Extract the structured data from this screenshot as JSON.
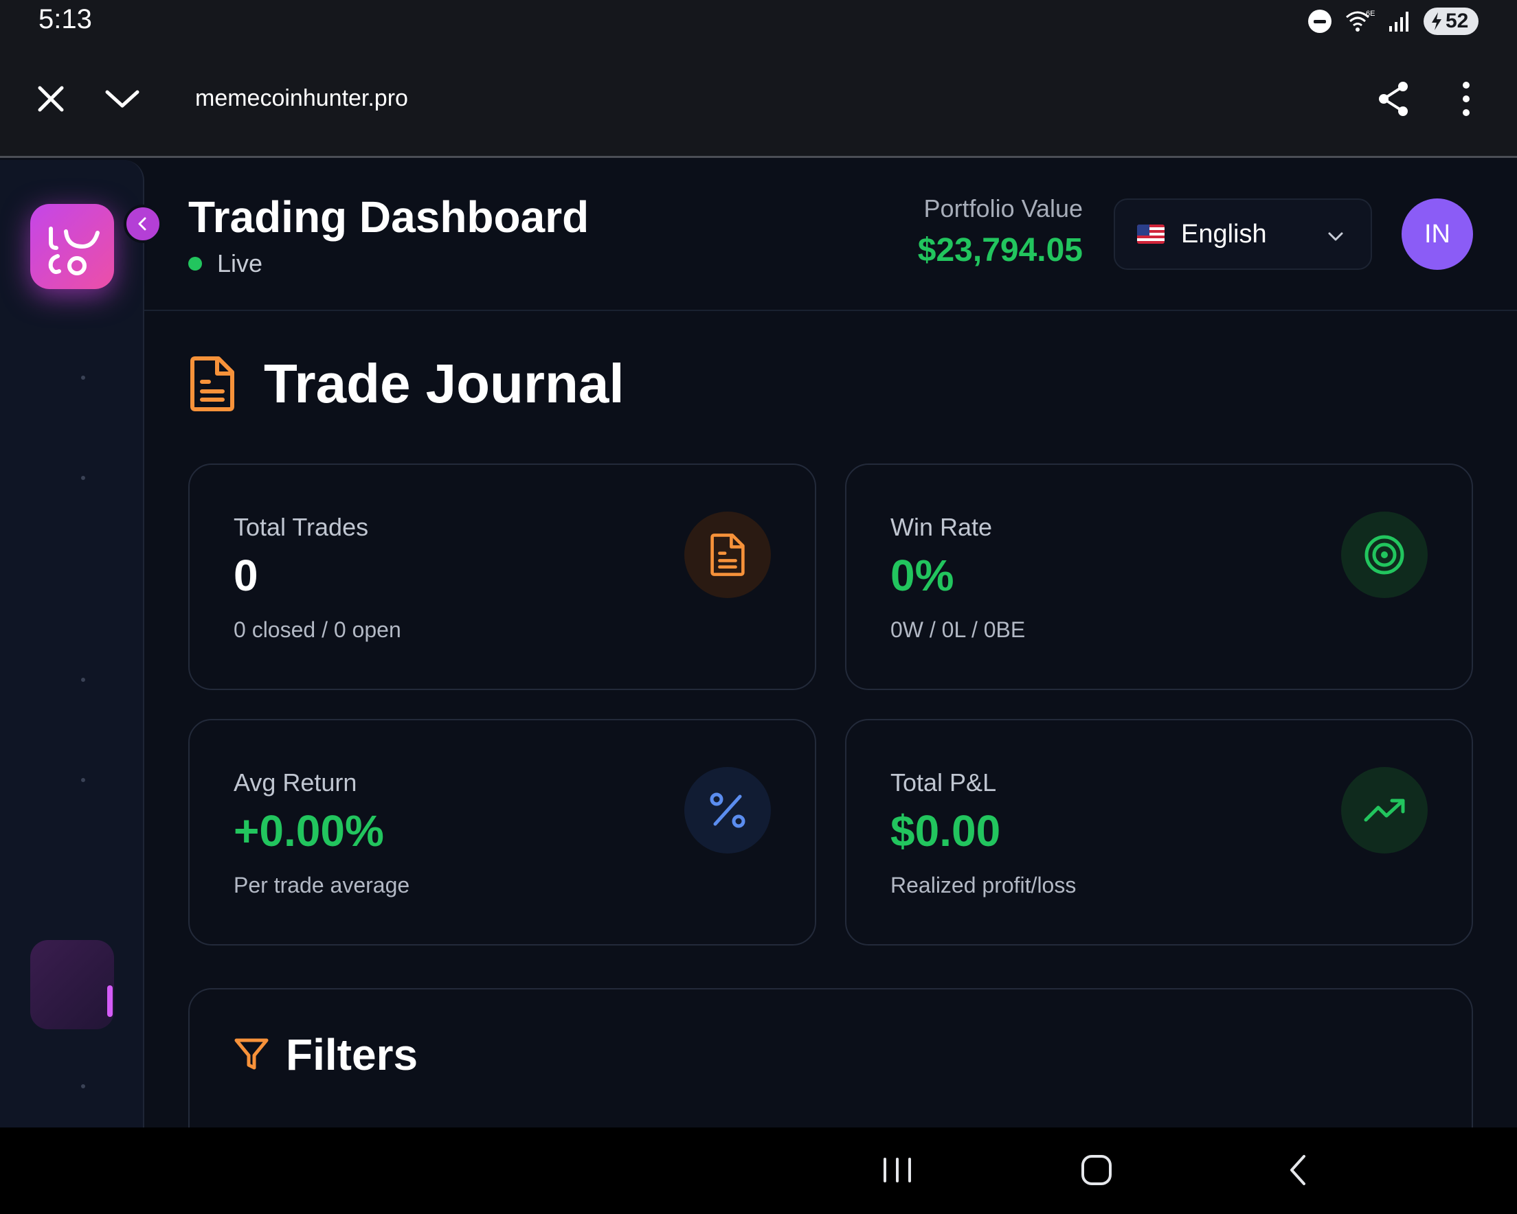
{
  "status_bar": {
    "time": "5:13",
    "network": "6E",
    "battery": "52"
  },
  "browser": {
    "url": "memecoinhunter.pro"
  },
  "header": {
    "title": "Trading Dashboard",
    "status": "Live",
    "portfolio_label": "Portfolio Value",
    "portfolio_value": "$23,794.05",
    "language": "English",
    "avatar_initials": "IN"
  },
  "page": {
    "title": "Trade Journal"
  },
  "cards": [
    {
      "label": "Total Trades",
      "value": "0",
      "sub": "0 closed / 0 open",
      "icon": "document-icon",
      "value_color": "#ffffff"
    },
    {
      "label": "Win Rate",
      "value": "0%",
      "sub": "0W / 0L / 0BE",
      "icon": "target-icon",
      "value_color": "#22c55e"
    },
    {
      "label": "Avg Return",
      "value": "+0.00%",
      "sub": "Per trade average",
      "icon": "percent-icon",
      "value_color": "#22c55e"
    },
    {
      "label": "Total P&L",
      "value": "$0.00",
      "sub": "Realized profit/loss",
      "icon": "trending-up-icon",
      "value_color": "#22c55e"
    }
  ],
  "filters": {
    "title": "Filters"
  },
  "colors": {
    "accent_green": "#22c55e",
    "accent_orange": "#f7923a",
    "accent_purple": "#8b5cf6",
    "background": "#0b0f19"
  }
}
